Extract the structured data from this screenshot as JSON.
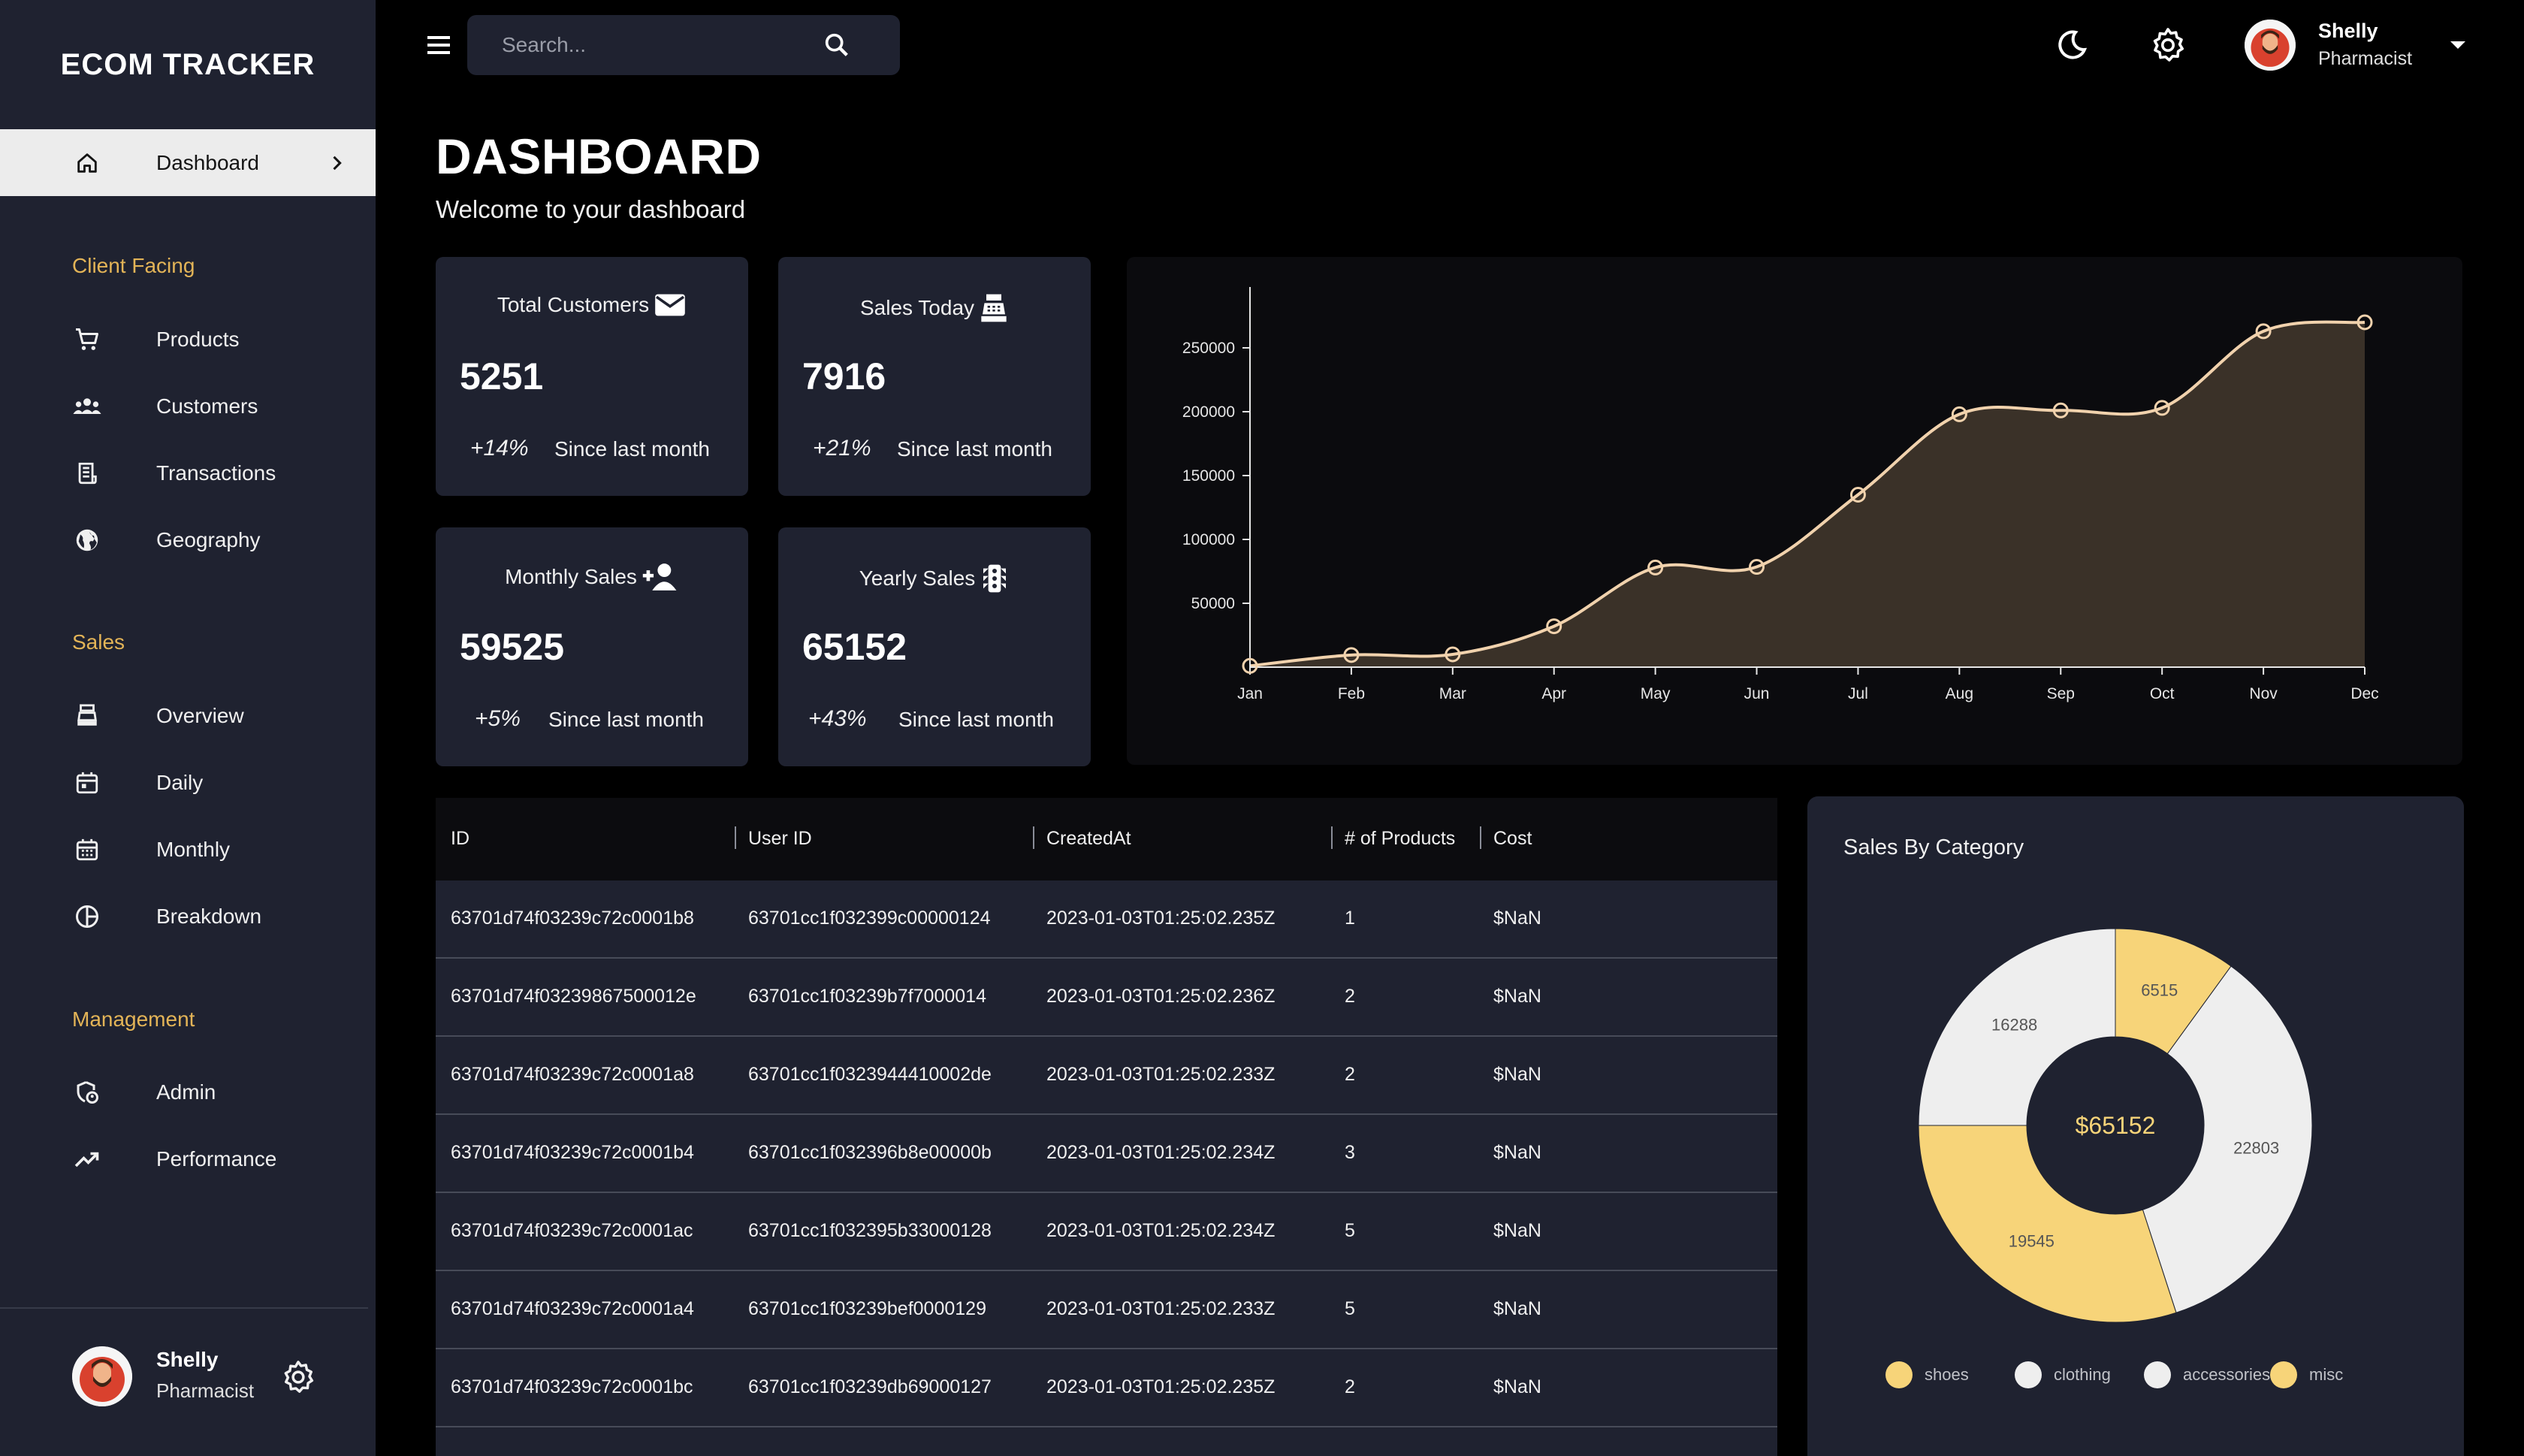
{
  "app": {
    "brand": "ECOM TRACKER"
  },
  "sidebar": {
    "active": {
      "label": "Dashboard",
      "icon": "home-icon"
    },
    "sections": [
      {
        "title": "Client Facing",
        "items": [
          {
            "label": "Products",
            "icon": "cart-icon"
          },
          {
            "label": "Customers",
            "icon": "groups-icon"
          },
          {
            "label": "Transactions",
            "icon": "receipt-icon"
          },
          {
            "label": "Geography",
            "icon": "globe-icon"
          }
        ]
      },
      {
        "title": "Sales",
        "items": [
          {
            "label": "Overview",
            "icon": "point-of-sale-icon"
          },
          {
            "label": "Daily",
            "icon": "calendar-today-icon"
          },
          {
            "label": "Monthly",
            "icon": "calendar-month-icon"
          },
          {
            "label": "Breakdown",
            "icon": "pie-chart-icon"
          }
        ]
      },
      {
        "title": "Management",
        "items": [
          {
            "label": "Admin",
            "icon": "admin-icon"
          },
          {
            "label": "Performance",
            "icon": "trending-up-icon"
          }
        ]
      }
    ],
    "user": {
      "name": "Shelly",
      "role": "Pharmacist"
    }
  },
  "topbar": {
    "search_placeholder": "Search...",
    "user": {
      "name": "Shelly",
      "role": "Pharmacist"
    }
  },
  "header": {
    "title": "DASHBOARD",
    "subtitle": "Welcome to your dashboard"
  },
  "stats": [
    {
      "title": "Total Customers",
      "icon": "email-icon",
      "value": "5251",
      "change": "+14%",
      "since": "Since last month"
    },
    {
      "title": "Sales Today",
      "icon": "point-of-sale-icon",
      "value": "7916",
      "change": "+21%",
      "since": "Since last month"
    },
    {
      "title": "Monthly Sales",
      "icon": "person-add-icon",
      "value": "59525",
      "change": "+5%",
      "since": "Since last month"
    },
    {
      "title": "Yearly Sales",
      "icon": "traffic-icon",
      "value": "65152",
      "change": "+43%",
      "since": "Since last month"
    }
  ],
  "table": {
    "columns": [
      "ID",
      "User ID",
      "CreatedAt",
      "# of Products",
      "Cost"
    ],
    "rows": [
      [
        "63701d74f03239c72c0001b8",
        "63701cc1f032399c00000124",
        "2023-01-03T01:25:02.235Z",
        "1",
        "$NaN"
      ],
      [
        "63701d74f03239867500012e",
        "63701cc1f03239b7f7000014",
        "2023-01-03T01:25:02.236Z",
        "2",
        "$NaN"
      ],
      [
        "63701d74f03239c72c0001a8",
        "63701cc1f0323944410002de",
        "2023-01-03T01:25:02.233Z",
        "2",
        "$NaN"
      ],
      [
        "63701d74f03239c72c0001b4",
        "63701cc1f032396b8e00000b",
        "2023-01-03T01:25:02.234Z",
        "3",
        "$NaN"
      ],
      [
        "63701d74f03239c72c0001ac",
        "63701cc1f032395b33000128",
        "2023-01-03T01:25:02.234Z",
        "5",
        "$NaN"
      ],
      [
        "63701d74f03239c72c0001a4",
        "63701cc1f03239bef0000129",
        "2023-01-03T01:25:02.233Z",
        "5",
        "$NaN"
      ],
      [
        "63701d74f03239c72c0001bc",
        "63701cc1f03239db69000127",
        "2023-01-03T01:25:02.235Z",
        "2",
        "$NaN"
      ]
    ]
  },
  "pie": {
    "title": "Sales By Category",
    "center_label": "$65152"
  },
  "colors": {
    "accent": "#e3b457",
    "panel": "#1f2230",
    "line": "#f1d2ad",
    "area": "#3a3128",
    "pie_yellow": "#f7d479",
    "pie_white": "#eeeeee"
  },
  "chart_data": [
    {
      "type": "area",
      "x": [
        "Jan",
        "Feb",
        "Mar",
        "Apr",
        "May",
        "Jun",
        "Jul",
        "Aug",
        "Sep",
        "Oct",
        "Nov",
        "Dec"
      ],
      "y": [
        1000,
        9500,
        10000,
        32000,
        78000,
        78500,
        135000,
        198000,
        201000,
        203000,
        263000,
        270000
      ],
      "yticks": [
        50000,
        100000,
        150000,
        200000,
        250000
      ],
      "ylim": [
        0,
        280000
      ],
      "grid": false
    },
    {
      "type": "pie",
      "donut": true,
      "slices": [
        {
          "label": "shoes",
          "value": 6515,
          "color": "#f7d479"
        },
        {
          "label": "clothing",
          "value": 22803,
          "color": "#eeeeee"
        },
        {
          "label": "accessories",
          "value": 19545,
          "color": "#f7d479"
        },
        {
          "label": "misc",
          "value": 16288,
          "color": "#eeeeee"
        }
      ],
      "legend": [
        {
          "label": "shoes",
          "color": "#f7d479"
        },
        {
          "label": "clothing",
          "color": "#eeeeee"
        },
        {
          "label": "accessories",
          "color": "#eeeeee"
        },
        {
          "label": "misc",
          "color": "#f7d479"
        }
      ],
      "legend_position": "bottom"
    }
  ]
}
